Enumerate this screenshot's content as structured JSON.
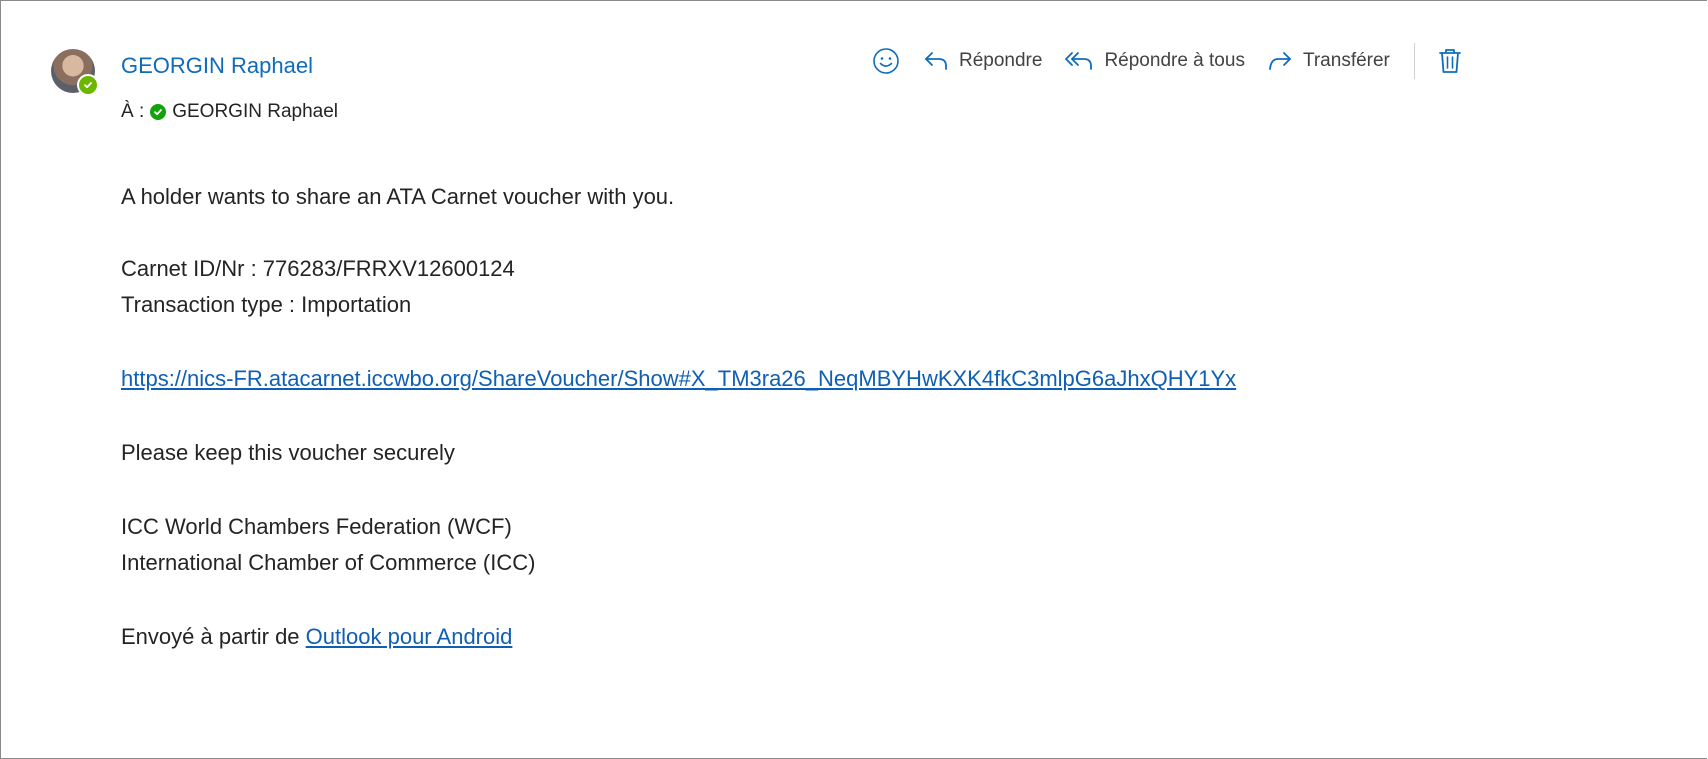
{
  "message": {
    "sender_name": "GEORGIN Raphael",
    "to_label": "À :",
    "to_name": "GEORGIN Raphael"
  },
  "toolbar": {
    "reply_label": "Répondre",
    "reply_all_label": "Répondre à tous",
    "forward_label": "Transférer"
  },
  "body": {
    "intro": "A holder wants to share an ATA Carnet voucher with you.",
    "carnet_line": "Carnet ID/Nr : 776283/FRRXV12600124",
    "transaction_line": "Transaction type : Importation",
    "voucher_link": "https://nics-FR.atacarnet.iccwbo.org/ShareVoucher/Show#X_TM3ra26_NeqMBYHwKXK4fkC3mlpG6aJhxQHY1Yx",
    "keep_note": "Please keep this voucher securely",
    "org_line_1": "ICC World Chambers Federation (WCF)",
    "org_line_2": "International Chamber of Commerce (ICC)",
    "sent_from_prefix": "Envoyé à partir de",
    "sent_from_link": "Outlook pour Android"
  },
  "colors": {
    "accent": "#0f6cbd",
    "link": "#0f5fb4",
    "presence": "#6bb700",
    "text": "#242424"
  },
  "icons": [
    "emoji-icon",
    "reply-icon",
    "reply-all-icon",
    "forward-icon",
    "delete-icon",
    "presence-check-icon"
  ]
}
